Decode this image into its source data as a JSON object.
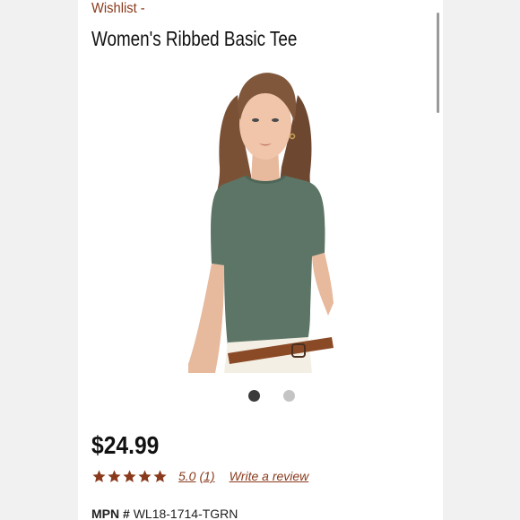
{
  "breadcrumb": "Wishlist -",
  "product": {
    "title": "Women's Ribbed Basic Tee",
    "price": "$24.99",
    "rating_value": "5.0",
    "review_count": "(1)",
    "write_review_label": "Write a review",
    "stars": 5,
    "mpn_label": "MPN #",
    "mpn_value": "WL18-1714-TGRN"
  },
  "carousel": {
    "total_slides": 2,
    "active_slide": 1
  },
  "colors": {
    "accent": "#8a3a1c",
    "shirt": "#5c7566",
    "background": "#f2f2f2"
  }
}
